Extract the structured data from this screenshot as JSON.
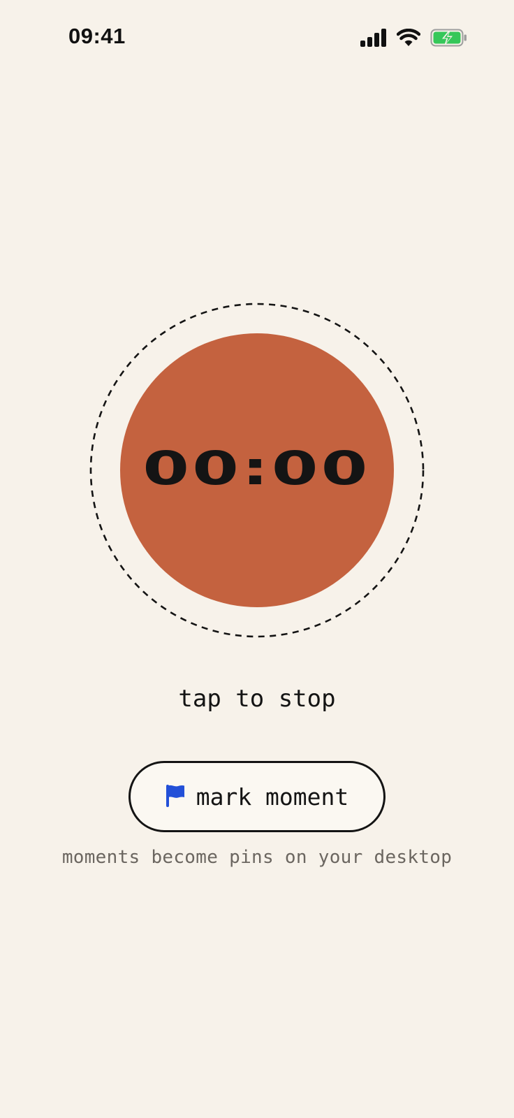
{
  "status_bar": {
    "time": "09:41",
    "icons": [
      "signal-icon",
      "wifi-icon",
      "battery-charging-icon"
    ],
    "battery_color": "#35C759"
  },
  "recorder": {
    "timer": "00:00",
    "button_color": "#C4623F",
    "hint": "tap to stop"
  },
  "mark_button": {
    "icon": "flag-icon",
    "icon_color": "#2350D8",
    "label": "mark moment"
  },
  "footnote": "moments become pins on your desktop",
  "colors": {
    "background": "#F7F2EA",
    "text": "#141414",
    "muted_text": "#6B6660"
  }
}
